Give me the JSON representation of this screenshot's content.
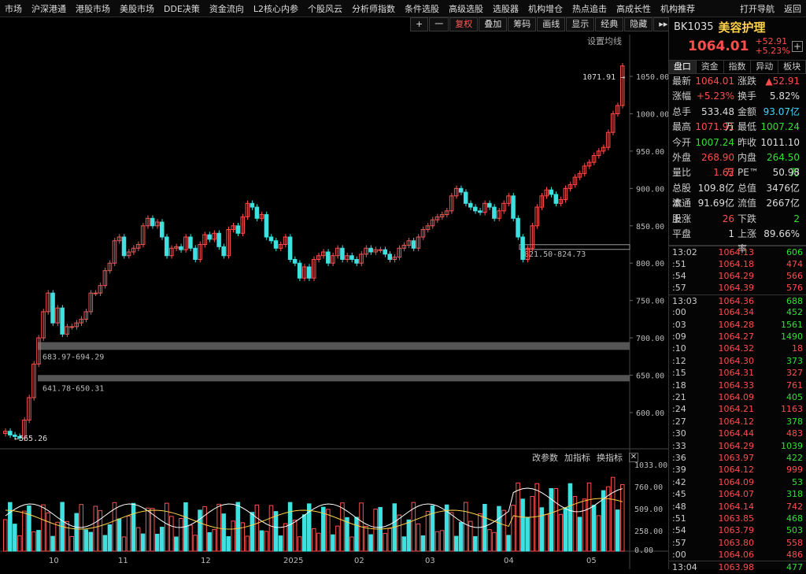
{
  "menu": [
    "市场",
    "沪深港通",
    "港股市场",
    "美股市场",
    "DDE决策",
    "资金流向",
    "L2核心内参",
    "个股风云",
    "分析师指数",
    "条件选股",
    "高级选股",
    "选股器",
    "机构增仓",
    "热点追击",
    "高成长性",
    "机构推荐",
    "打开导航",
    "返回"
  ],
  "toolbar": {
    "plus": "+",
    "minus": "一",
    "fuquan": "复权",
    "diejia": "叠加",
    "chouma": "筹码",
    "huaxian": "画线",
    "xianshi": "显示",
    "jingdian": "经典",
    "yincang": "隐藏",
    "more": "▸▸"
  },
  "settings": "设置均线",
  "indicators": {
    "params": "改参数",
    "add": "加指标",
    "change": "换指标",
    "close": "✕"
  },
  "quote": {
    "code": "BK1035",
    "name": "美容护理",
    "last": "1064.01",
    "chg": "+52.91",
    "pct": "+5.23%"
  },
  "tabs": [
    "盘口",
    "资金",
    "指数",
    "异动",
    "板块"
  ],
  "stats": [
    [
      {
        "l": "最新",
        "v": "1064.01",
        "c": "red"
      },
      {
        "l": "涨跌",
        "v": "▲52.91",
        "c": "red"
      }
    ],
    [
      {
        "l": "涨幅",
        "v": "+5.23%",
        "c": "red"
      },
      {
        "l": "换手",
        "v": "5.82%",
        "c": "white"
      }
    ],
    [
      {
        "l": "总手",
        "v": "533.48万",
        "c": "white"
      },
      {
        "l": "金额",
        "v": "93.07亿",
        "c": "cyan"
      }
    ],
    [
      {
        "l": "最高",
        "v": "1071.91",
        "c": "red"
      },
      {
        "l": "最低",
        "v": "1007.24",
        "c": "green"
      }
    ],
    [
      {
        "l": "今开",
        "v": "1007.24",
        "c": "green"
      },
      {
        "l": "昨收",
        "v": "1011.10",
        "c": "white"
      }
    ],
    [
      {
        "l": "外盘",
        "v": "268.90万",
        "c": "red"
      },
      {
        "l": "内盘",
        "v": "264.50万",
        "c": "green"
      }
    ],
    [
      {
        "l": "量比",
        "v": "1.62",
        "c": "red"
      },
      {
        "l": "PE™",
        "v": "50.98",
        "c": "white"
      }
    ],
    [
      {
        "l": "总股本",
        "v": "109.8亿",
        "c": "white"
      },
      {
        "l": "总值",
        "v": "3476亿",
        "c": "white"
      }
    ],
    [
      {
        "l": "流通股",
        "v": "91.69亿",
        "c": "white"
      },
      {
        "l": "流值",
        "v": "2667亿",
        "c": "white"
      }
    ],
    [
      {
        "l": "上涨",
        "v": "26",
        "c": "red"
      },
      {
        "l": "下跌",
        "v": "2",
        "c": "green"
      }
    ],
    [
      {
        "l": "平盘",
        "v": "1",
        "c": "white"
      },
      {
        "l": "上涨率",
        "v": "89.66%",
        "c": "white"
      }
    ]
  ],
  "ticks": [
    {
      "t": "13:02",
      "p": "1064.13",
      "q": "606",
      "c": "green"
    },
    {
      "t": ":51",
      "p": "1064.18",
      "q": "474",
      "c": "red"
    },
    {
      "t": ":54",
      "p": "1064.29",
      "q": "566",
      "c": "red"
    },
    {
      "t": ":57",
      "p": "1064.39",
      "q": "576",
      "c": "red"
    },
    {
      "t": "13:03",
      "p": "1064.36",
      "q": "688",
      "c": "green"
    },
    {
      "t": ":00",
      "p": "1064.34",
      "q": "452",
      "c": "green"
    },
    {
      "t": ":03",
      "p": "1064.28",
      "q": "1561",
      "c": "green"
    },
    {
      "t": ":09",
      "p": "1064.27",
      "q": "1490",
      "c": "green"
    },
    {
      "t": ":10",
      "p": "1064.32",
      "q": "18",
      "c": "red"
    },
    {
      "t": ":12",
      "p": "1064.30",
      "q": "373",
      "c": "green"
    },
    {
      "t": ":15",
      "p": "1064.31",
      "q": "327",
      "c": "red"
    },
    {
      "t": ":18",
      "p": "1064.33",
      "q": "761",
      "c": "red"
    },
    {
      "t": ":21",
      "p": "1064.09",
      "q": "405",
      "c": "green"
    },
    {
      "t": ":24",
      "p": "1064.21",
      "q": "1163",
      "c": "red"
    },
    {
      "t": ":27",
      "p": "1064.12",
      "q": "378",
      "c": "green"
    },
    {
      "t": ":30",
      "p": "1064.44",
      "q": "483",
      "c": "red"
    },
    {
      "t": ":33",
      "p": "1064.29",
      "q": "1039",
      "c": "green"
    },
    {
      "t": ":36",
      "p": "1063.97",
      "q": "422",
      "c": "green"
    },
    {
      "t": ":39",
      "p": "1064.12",
      "q": "999",
      "c": "red"
    },
    {
      "t": ":42",
      "p": "1064.09",
      "q": "53",
      "c": "green"
    },
    {
      "t": ":45",
      "p": "1064.07",
      "q": "318",
      "c": "green"
    },
    {
      "t": ":48",
      "p": "1064.14",
      "q": "742",
      "c": "red"
    },
    {
      "t": ":51",
      "p": "1063.85",
      "q": "468",
      "c": "green"
    },
    {
      "t": ":54",
      "p": "1063.79",
      "q": "503",
      "c": "green"
    },
    {
      "t": ":57",
      "p": "1063.80",
      "q": "558",
      "c": "red"
    },
    {
      "t": ":00",
      "p": "1064.06",
      "q": "486",
      "c": "red"
    },
    {
      "t": "13:04",
      "p": "1063.98",
      "q": "477",
      "c": "green"
    }
  ],
  "chart": {
    "price_ticks": [
      1050,
      1000,
      950,
      900,
      850,
      800,
      750,
      700,
      650,
      600
    ],
    "volume_ticks": [
      "1033.00",
      "760.00",
      "509.00",
      "258.00",
      "0.00"
    ],
    "date_labels": [
      "10",
      "11",
      "12",
      "2025",
      "02",
      "03",
      "04",
      "05"
    ],
    "max_label": "1071.91",
    "min_label": "565.26",
    "zones": [
      {
        "label": "683.97-694.29",
        "from": 683.97,
        "to": 694.29
      },
      {
        "label": "641.78-650.31",
        "from": 641.78,
        "to": 650.31
      },
      {
        "label": "821.50-824.73",
        "from": 821.5,
        "to": 824.73
      }
    ],
    "closes": [
      575,
      570,
      568,
      566,
      590,
      620,
      665,
      700,
      735,
      760,
      720,
      740,
      705,
      715,
      715,
      720,
      725,
      735,
      760,
      760,
      770,
      790,
      800,
      830,
      835,
      810,
      815,
      820,
      825,
      850,
      860,
      850,
      855,
      835,
      810,
      820,
      822,
      818,
      835,
      820,
      805,
      825,
      838,
      832,
      840,
      822,
      810,
      845,
      850,
      840,
      862,
      880,
      875,
      860,
      865,
      835,
      830,
      820,
      825,
      835,
      805,
      800,
      780,
      795,
      780,
      805,
      810,
      815,
      800,
      810,
      820,
      805,
      810,
      805,
      800,
      812,
      820,
      815,
      818,
      818,
      812,
      805,
      808,
      820,
      824,
      830,
      820,
      835,
      845,
      850,
      858,
      862,
      865,
      870,
      890,
      900,
      895,
      880,
      875,
      870,
      868,
      880,
      875,
      860,
      870,
      880,
      890,
      860,
      835,
      805,
      820,
      850,
      875,
      890,
      898,
      892,
      880,
      885,
      900,
      905,
      915,
      920,
      930,
      935,
      944,
      950,
      955,
      975,
      1000,
      1011,
      1064
    ],
    "vol_colors": "rggrrgrgrrgrgrrgrggrrggrgrrgrgrrggrrgrgrrgrgrrggrgrrgrgrrggrgrrggrrgrgrrgrgrrgrgrrgrggrrgrgrrgrggrrgrgrrgrgrrggrrgrgrrggrgrrgrgrrgr"
  }
}
